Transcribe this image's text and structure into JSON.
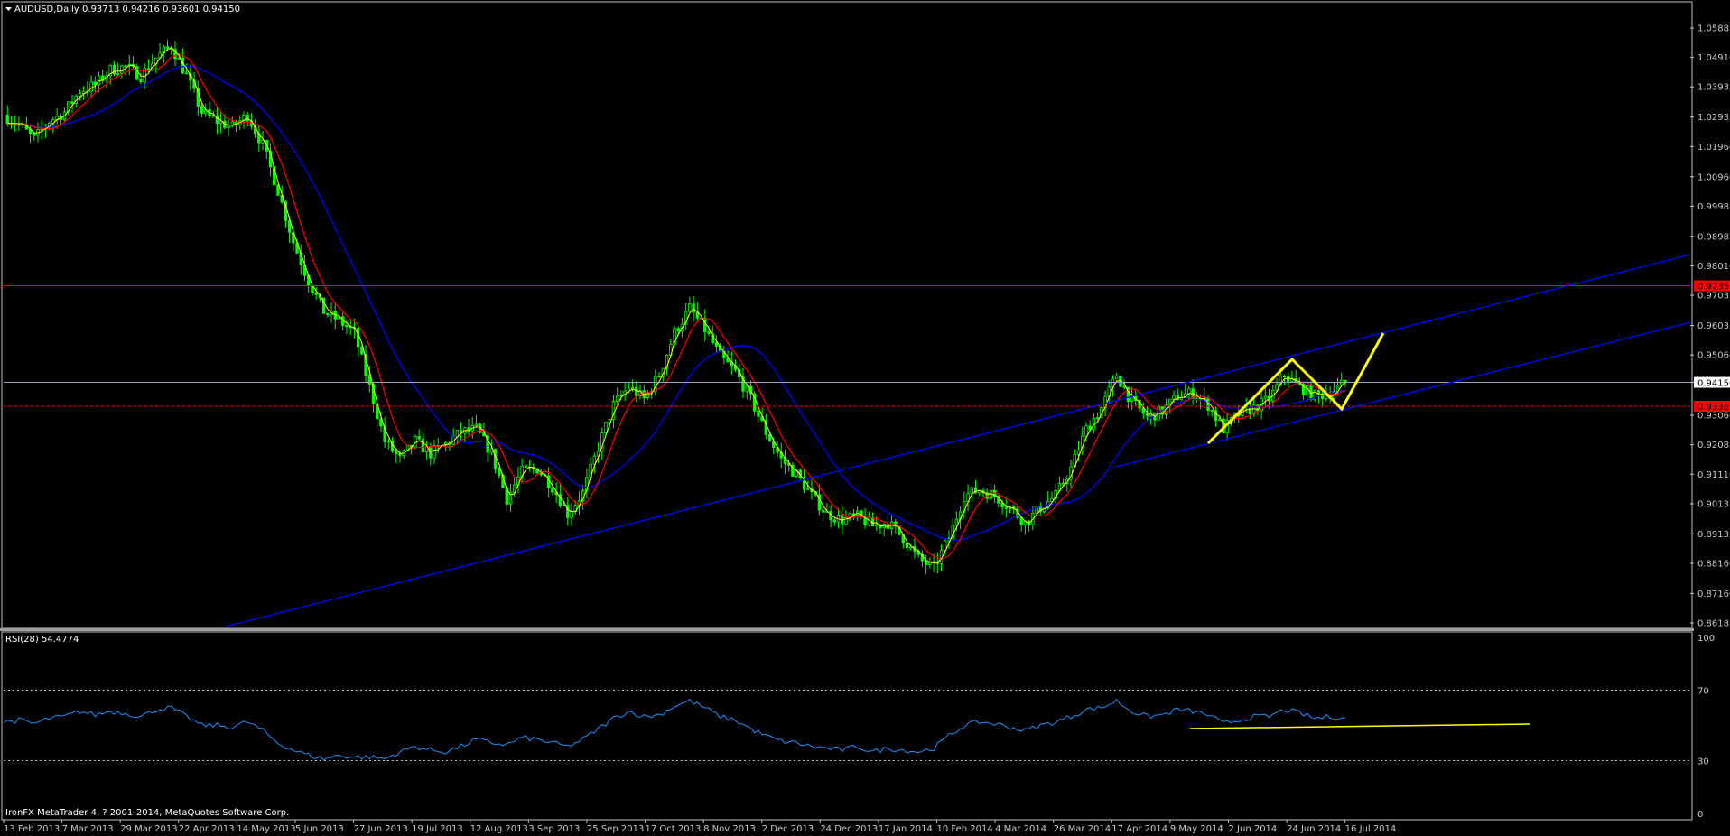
{
  "window": {
    "symbol_label": "AUDUSD,Daily",
    "ohlc_label": "0.93713 0.94216 0.93601 0.94150",
    "rsi_label": "RSI(28) 54.4774",
    "copyright": "IronFX MetaTrader 4, ? 2001-2014, MetaQuotes Software Corp."
  },
  "colors": {
    "background": "#000000",
    "frame": "#c0c0c0",
    "bull_candle": "#00ff00",
    "bear_candle": "#00ff00",
    "ma_fast": "#ff0000",
    "ma_slow": "#0000ff",
    "ma_short": "#ffff00",
    "trendline": "#0000ff",
    "pattern": "#ffff00",
    "rsi_line": "#1e90ff",
    "resistance_line": "#ff0000",
    "current_price_line": "#9aa4b4"
  },
  "chart_data": [
    {
      "type": "line",
      "title": "AUDUSD,Daily",
      "ylim": [
        0.86185,
        1.05885
      ],
      "y_ticks": [
        "1.05885",
        "1.04910",
        "1.03935",
        "1.02935",
        "1.01960",
        "1.00960",
        "0.99985",
        "0.98985",
        "0.98010",
        "0.97035",
        "0.96035",
        "0.95060",
        "0.94150",
        "0.93060",
        "0.92085",
        "0.91110",
        "0.90135",
        "0.89135",
        "0.88160",
        "0.87160",
        "0.86185"
      ],
      "x_ticks": [
        "13 Feb 2013",
        "7 Mar 2013",
        "29 Mar 2013",
        "22 Apr 2013",
        "14 May 2013",
        "5 Jun 2013",
        "27 Jun 2013",
        "19 Jul 2013",
        "12 Aug 2013",
        "3 Sep 2013",
        "25 Sep 2013",
        "17 Oct 2013",
        "8 Nov 2013",
        "2 Dec 2013",
        "24 Dec 2013",
        "17 Jan 2014",
        "10 Feb 2014",
        "4 Mar 2014",
        "26 Mar 2014",
        "17 Apr 2014",
        "9 May 2014",
        "2 Jun 2014",
        "24 Jun 2014",
        "16 Jul 2014"
      ],
      "series": [
        {
          "values": [
            1.03,
            1.027,
            1.022,
            1.028,
            1.031,
            1.038,
            1.04,
            1.045,
            1.046,
            1.043,
            1.049,
            1.053,
            1.043,
            1.031,
            1.028,
            1.026,
            1.03,
            1.02,
            1.005,
            0.988,
            0.975,
            0.965,
            0.962,
            0.958,
            0.94,
            0.922,
            0.916,
            0.922,
            0.918,
            0.921,
            0.925,
            0.926,
            0.918,
            0.903,
            0.912,
            0.913,
            0.907,
            0.898,
            0.905,
            0.92,
            0.934,
            0.94,
            0.936,
            0.944,
            0.958,
            0.966,
            0.959,
            0.95,
            0.945,
            0.936,
            0.925,
            0.916,
            0.911,
            0.904,
            0.898,
            0.896,
            0.897,
            0.894,
            0.895,
            0.89,
            0.883,
            0.88,
            0.89,
            0.904,
            0.906,
            0.904,
            0.9,
            0.895,
            0.9,
            0.904,
            0.913,
            0.926,
            0.933,
            0.944,
            0.935,
            0.93,
            0.932,
            0.937,
            0.938,
            0.934,
            0.926,
            0.931,
            0.933,
            0.936,
            0.944,
            0.94,
            0.937,
            0.938,
            0.9415
          ]
        }
      ],
      "horizontal_lines": [
        {
          "price": 0.9735,
          "label": "0.9735"
        },
        {
          "price": 0.9415,
          "label": "0.94150"
        },
        {
          "price": 0.9336,
          "label": "0.9336"
        }
      ]
    },
    {
      "type": "line",
      "title": "RSI(28) 54.4774",
      "ylim": [
        0,
        100
      ],
      "y_ticks": [
        "100",
        "70",
        "30",
        "0"
      ],
      "levels": [
        70,
        30
      ],
      "series": [
        {
          "values": [
            52,
            53,
            51,
            54,
            55,
            58,
            56,
            58,
            57,
            55,
            59,
            60,
            55,
            50,
            50,
            49,
            52,
            47,
            40,
            36,
            33,
            31,
            33,
            32,
            32,
            31,
            35,
            38,
            36,
            35,
            38,
            42,
            40,
            39,
            43,
            42,
            40,
            38,
            42,
            48,
            54,
            58,
            55,
            56,
            61,
            64,
            60,
            55,
            53,
            48,
            44,
            41,
            40,
            38,
            37,
            36,
            38,
            35,
            37,
            36,
            35,
            37,
            44,
            50,
            52,
            51,
            49,
            47,
            50,
            52,
            55,
            59,
            60,
            64,
            58,
            55,
            56,
            59,
            58,
            56,
            51,
            53,
            55,
            55,
            59,
            57,
            54,
            55,
            54.4774
          ]
        }
      ]
    }
  ]
}
